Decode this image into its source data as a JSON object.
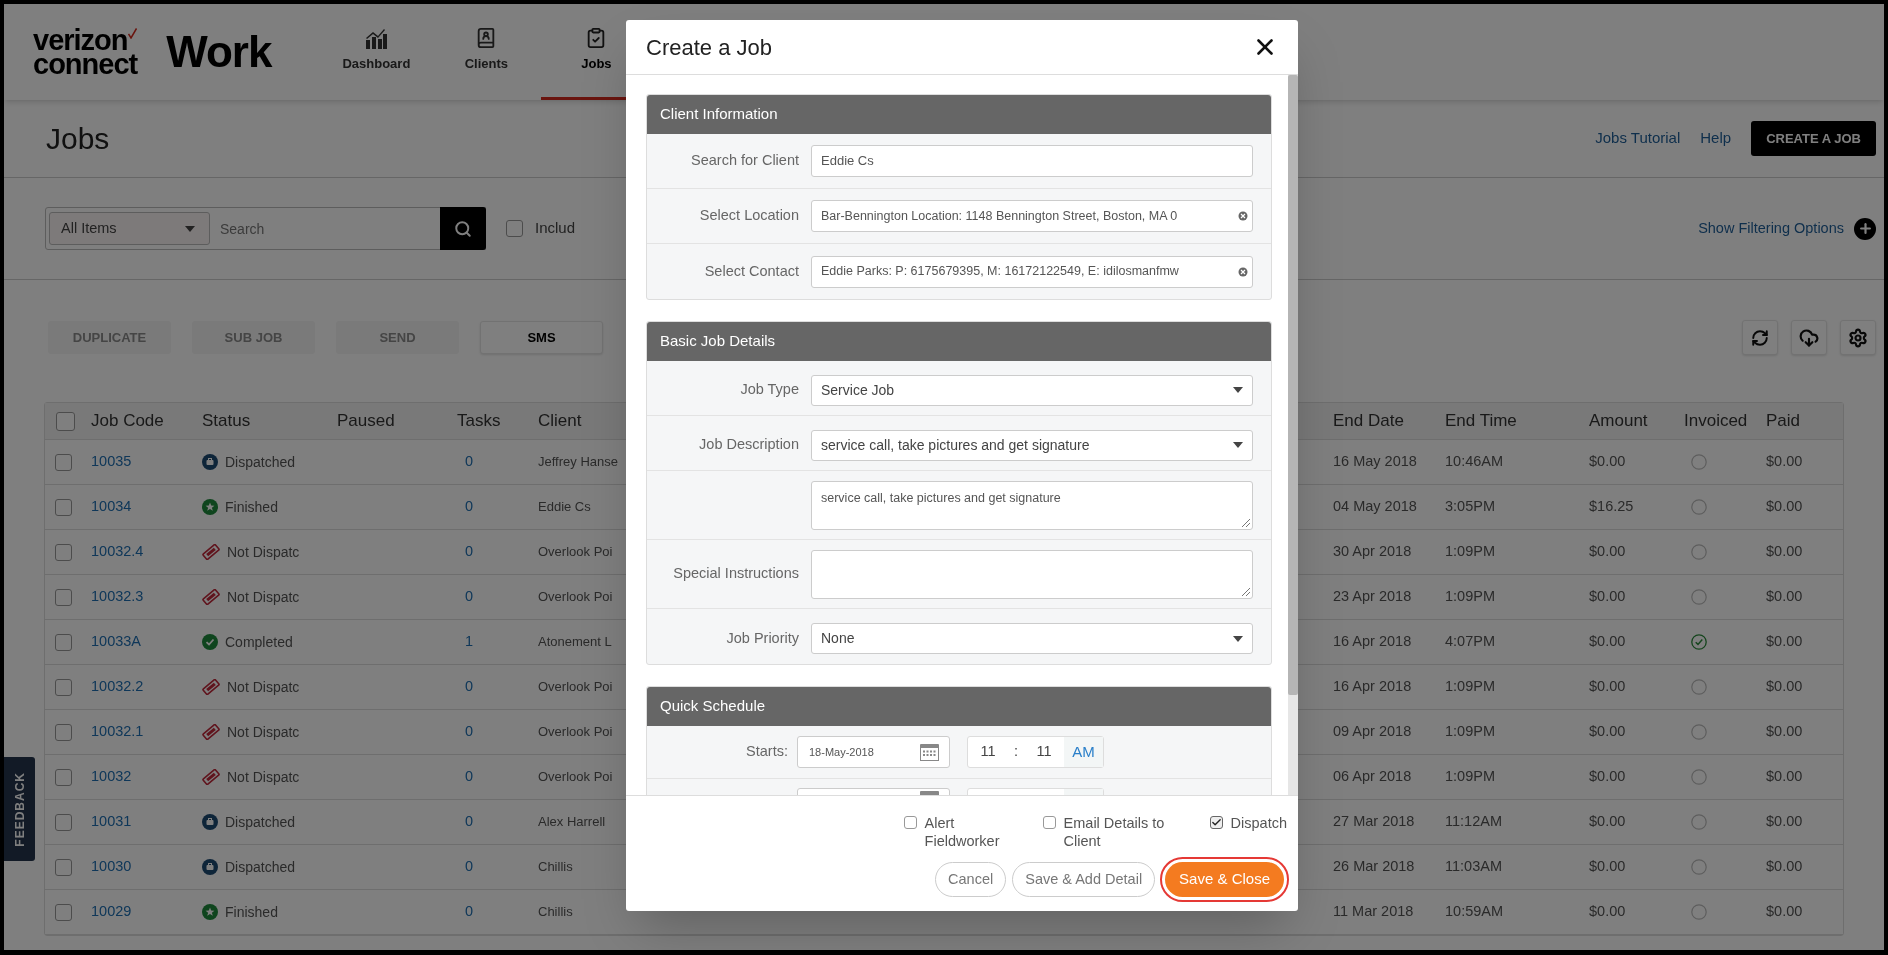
{
  "header": {
    "logo_top": "verizon",
    "logo_bottom": "connect",
    "product": "Work",
    "nav": [
      {
        "label": "Dashboard",
        "selected": false
      },
      {
        "label": "Clients",
        "selected": false
      },
      {
        "label": "Jobs",
        "selected": true
      }
    ]
  },
  "page": {
    "title": "Jobs",
    "links": [
      "Jobs Tutorial",
      "Help"
    ],
    "primary_button": "CREATE A JOB"
  },
  "filter": {
    "scope": "All Items",
    "search_placeholder": "Search",
    "include": {
      "label": "Includ",
      "checked": false
    },
    "toggle_link": "Show Filtering Options"
  },
  "actions": [
    {
      "label": "DUPLICATE",
      "disabled": true
    },
    {
      "label": "SUB JOB",
      "disabled": true
    },
    {
      "label": "SEND",
      "disabled": true
    },
    {
      "label": "SMS",
      "disabled": false
    }
  ],
  "table": {
    "select_all_checked": false,
    "columns": [
      "Job Code",
      "Status",
      "Paused",
      "Tasks",
      "Client",
      "End Date",
      "End Time",
      "Amount",
      "Invoiced",
      "Paid"
    ],
    "rows": [
      {
        "checked": false,
        "code": "10035",
        "status": "Dispatched",
        "kind": "dispatched",
        "tasks": "0",
        "client": "Jeffrey Hanse",
        "end_date": "16 May 2018",
        "end_time": "10:46AM",
        "amount": "$0.00",
        "invoiced": false,
        "paid": "$0.00"
      },
      {
        "checked": false,
        "code": "10034",
        "status": "Finished",
        "kind": "finished",
        "tasks": "0",
        "client": "Eddie Cs",
        "end_date": "04 May 2018",
        "end_time": "3:05PM",
        "amount": "$16.25",
        "invoiced": false,
        "paid": "$0.00"
      },
      {
        "checked": false,
        "code": "10032.4",
        "status": "Not Dispatc",
        "kind": "not_dispatched",
        "tasks": "0",
        "client": "Overlook Poi",
        "end_date": "30 Apr 2018",
        "end_time": "1:09PM",
        "amount": "$0.00",
        "invoiced": false,
        "paid": "$0.00"
      },
      {
        "checked": false,
        "code": "10032.3",
        "status": "Not Dispatc",
        "kind": "not_dispatched",
        "tasks": "0",
        "client": "Overlook Poi",
        "end_date": "23 Apr 2018",
        "end_time": "1:09PM",
        "amount": "$0.00",
        "invoiced": false,
        "paid": "$0.00"
      },
      {
        "checked": false,
        "code": "10033A",
        "status": "Completed",
        "kind": "completed",
        "tasks": "1",
        "client": "Atonement L",
        "end_date": "16 Apr 2018",
        "end_time": "4:07PM",
        "amount": "$0.00",
        "invoiced": true,
        "paid": "$0.00"
      },
      {
        "checked": false,
        "code": "10032.2",
        "status": "Not Dispatc",
        "kind": "not_dispatched",
        "tasks": "0",
        "client": "Overlook Poi",
        "end_date": "16 Apr 2018",
        "end_time": "1:09PM",
        "amount": "$0.00",
        "invoiced": false,
        "paid": "$0.00"
      },
      {
        "checked": false,
        "code": "10032.1",
        "status": "Not Dispatc",
        "kind": "not_dispatched",
        "tasks": "0",
        "client": "Overlook Poi",
        "end_date": "09 Apr 2018",
        "end_time": "1:09PM",
        "amount": "$0.00",
        "invoiced": false,
        "paid": "$0.00"
      },
      {
        "checked": false,
        "code": "10032",
        "status": "Not Dispatc",
        "kind": "not_dispatched",
        "tasks": "0",
        "client": "Overlook Poi",
        "end_date": "06 Apr 2018",
        "end_time": "1:09PM",
        "amount": "$0.00",
        "invoiced": false,
        "paid": "$0.00"
      },
      {
        "checked": false,
        "code": "10031",
        "status": "Dispatched",
        "kind": "dispatched",
        "tasks": "0",
        "client": "Alex Harrell",
        "end_date": "27 Mar 2018",
        "end_time": "11:12AM",
        "amount": "$0.00",
        "invoiced": false,
        "paid": "$0.00"
      },
      {
        "checked": false,
        "code": "10030",
        "status": "Dispatched",
        "kind": "dispatched",
        "tasks": "0",
        "client": "Chillis",
        "end_date": "26 Mar 2018",
        "end_time": "11:03AM",
        "amount": "$0.00",
        "invoiced": false,
        "paid": "$0.00"
      },
      {
        "checked": false,
        "code": "10029",
        "status": "Finished",
        "kind": "finished",
        "tasks": "0",
        "client": "Chillis",
        "end_date": "11 Mar 2018",
        "end_time": "10:59AM",
        "amount": "$0.00",
        "invoiced": false,
        "paid": "$0.00"
      }
    ]
  },
  "feedback": "FEEDBACK",
  "modal": {
    "title": "Create a Job",
    "sections": [
      {
        "title": "Client Information",
        "fields": [
          {
            "kind": "input",
            "label": "Search for Client",
            "value": "Eddie Cs"
          },
          {
            "kind": "combo",
            "label": "Select Location",
            "value": "Bar-Bennington Location: 1148 Bennington Street, Boston, MA 0"
          },
          {
            "kind": "combo",
            "label": "Select Contact",
            "value": "Eddie Parks: P: 6175679395, M: 16172122549, E: idilosmanfmw"
          }
        ]
      },
      {
        "title": "Basic Job Details",
        "fields": [
          {
            "kind": "select",
            "label": "Job Type",
            "value": "Service Job"
          },
          {
            "kind": "select",
            "label": "Job Description",
            "value": "service call, take pictures and get signature"
          },
          {
            "kind": "textarea",
            "value": "service call, take pictures and get signature"
          },
          {
            "kind": "textarea",
            "label": "Special Instructions"
          },
          {
            "kind": "select",
            "label": "Job Priority",
            "value": "None"
          }
        ]
      },
      {
        "title": "Quick Schedule",
        "fields": [
          {
            "kind": "datetime",
            "label": "Starts:",
            "date": "18-May-2018",
            "hour": "11",
            "separator": ":",
            "minute": "11",
            "meridiem": "AM"
          },
          {
            "kind": "datetime_cut"
          }
        ]
      }
    ],
    "options": [
      {
        "label": "Alert Fieldworker",
        "checked": false
      },
      {
        "label": "Email Details to Client",
        "checked": false
      },
      {
        "label": "Dispatch",
        "checked": true
      }
    ],
    "buttons": [
      {
        "label": "Cancel",
        "kind": "secondary",
        "highlighted": false
      },
      {
        "label": "Save & Add Detail",
        "kind": "secondary",
        "highlighted": false
      },
      {
        "label": "Save & Close",
        "kind": "primary",
        "highlighted": true
      }
    ]
  }
}
